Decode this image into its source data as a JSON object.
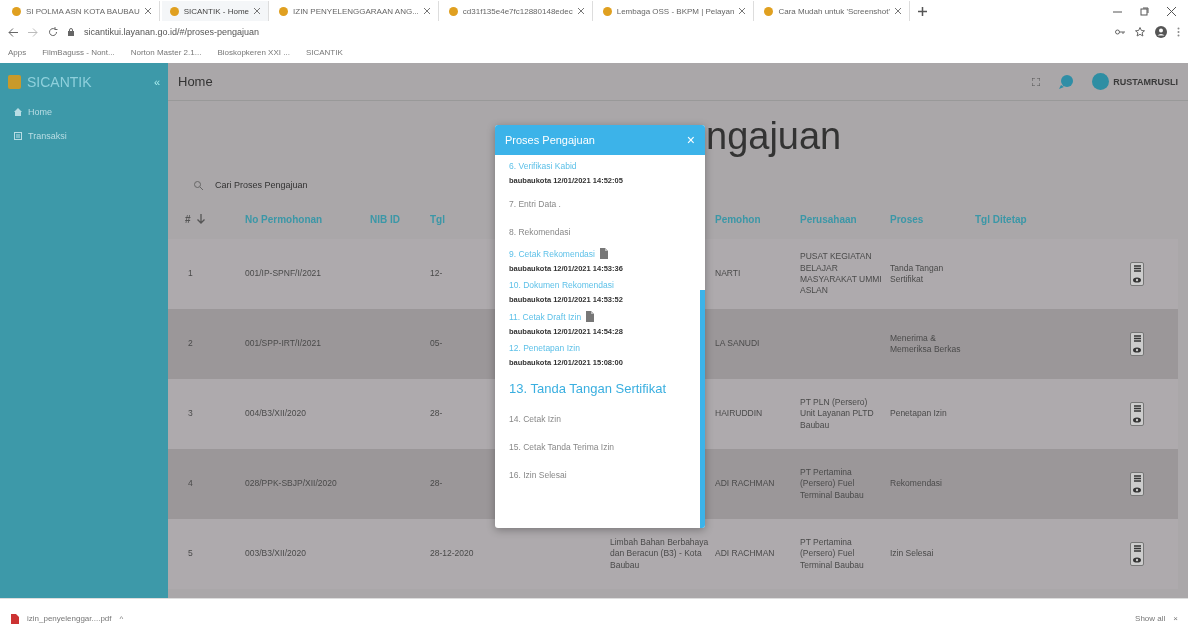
{
  "browser": {
    "tabs": [
      {
        "title": "SI POLMA ASN KOTA BAUBAU",
        "selected": false
      },
      {
        "title": "SICANTIK - Home",
        "selected": true
      },
      {
        "title": "IZIN PENYELENGGARAAN ANG...",
        "selected": false
      },
      {
        "title": "cd31f135e4e7fc12880148edec",
        "selected": false
      },
      {
        "title": "Lembaga OSS - BKPM | Pelayan",
        "selected": false
      },
      {
        "title": "Cara Mudah untuk 'Screenshot'",
        "selected": false
      }
    ],
    "address": "sicantikui.layanan.go.id/#/proses-pengajuan",
    "bookmarks": [
      "Apps",
      "FilmBaguss - Nont...",
      "Norton Master 2.1...",
      "Bioskopkeren XXI ...",
      "SICANTIK"
    ]
  },
  "sidebar": {
    "brand": "SICANTIK",
    "collapse": "«",
    "items": [
      {
        "label": "Home",
        "selected": false
      },
      {
        "label": "Transaksi",
        "selected": false
      }
    ]
  },
  "header": {
    "title": "Home",
    "user": "RUSTAMRUSLI"
  },
  "page_title": "ngajuan",
  "search": {
    "placeholder": "Cari Proses Pengajuan"
  },
  "table": {
    "columns": [
      "#",
      "No Permohonan",
      "NIB ID",
      "Tgl",
      "Pemohon",
      "Perusahaan",
      "Proses",
      "Tgl Ditetap"
    ],
    "rows": [
      {
        "no": "1",
        "permohonan": "001/IP-SPNF/I/2021",
        "tgl": "12-",
        "pemohon": "NARTI",
        "perusahaan": "PUSAT KEGIATAN BELAJAR MASYARAKAT UMMI ASLAN",
        "proses": "Tanda Tangan Sertifikat"
      },
      {
        "no": "2",
        "permohonan": "001/SPP-IRT/I/2021",
        "tgl": "05-",
        "pemohon": "LA SANUDI",
        "proses": "Menerima & Memeriksa Berkas"
      },
      {
        "no": "3",
        "permohonan": "004/B3/XII/2020",
        "tgl": "28-",
        "pemohon": "HAIRUDDIN",
        "perusahaan": "PT PLN (Persero) Unit Layanan PLTD Baubau",
        "proses": "Penetapan Izin"
      },
      {
        "no": "4",
        "permohonan": "028/PPK-SBJP/XII/2020",
        "tgl": "28-",
        "pemohon": "ADI RACHMAN",
        "perusahaan": "PT Pertamina (Persero) Fuel Terminal Baubau",
        "proses": "Rekomendasi"
      },
      {
        "no": "5",
        "permohonan": "003/B3/XII/2020",
        "tgl": "28-12-2020",
        "izin": "Limbah Bahan Berbahaya dan Beracun (B3) - Kota Baubau",
        "pemohon": "ADI RACHMAN",
        "perusahaan": "PT Pertamina (Persero) Fuel Terminal Baubau",
        "proses": "Izin Selesai"
      }
    ]
  },
  "modal": {
    "title": "Proses Pengajuan",
    "close": "×",
    "steps": [
      {
        "label": "6. Verifikasi Kabid",
        "done": true,
        "current": false,
        "meta": "baubaukota 12/01/2021 14:52:05"
      },
      {
        "label": "7. Entri Data .",
        "done": false,
        "current": false
      },
      {
        "label": "8. Rekomendasi",
        "done": false,
        "current": false
      },
      {
        "label": "9. Cetak Rekomendasi",
        "done": true,
        "current": false,
        "file": true,
        "meta": "baubaukota 12/01/2021 14:53:36"
      },
      {
        "label": "10. Dokumen Rekomendasi",
        "done": true,
        "current": false,
        "meta": "baubaukota 12/01/2021 14:53:52"
      },
      {
        "label": "11. Cetak Draft Izin",
        "done": true,
        "current": false,
        "file": true,
        "meta": "baubaukota 12/01/2021 14:54:28"
      },
      {
        "label": "12. Penetapan Izin",
        "done": true,
        "current": false,
        "meta": "baubaukota 12/01/2021 15:08:00"
      },
      {
        "label": "13. Tanda Tangan Sertifikat",
        "done": false,
        "current": true
      },
      {
        "label": "14. Cetak Izin",
        "done": false,
        "current": false
      },
      {
        "label": "15. Cetak Tanda Terima Izin",
        "done": false,
        "current": false
      },
      {
        "label": "16. Izin Selesai",
        "done": false,
        "current": false
      }
    ]
  },
  "download_bar": {
    "file": "izin_penyelenggar....pdf",
    "caret": "^",
    "show_all": "Show all",
    "close": "×"
  }
}
